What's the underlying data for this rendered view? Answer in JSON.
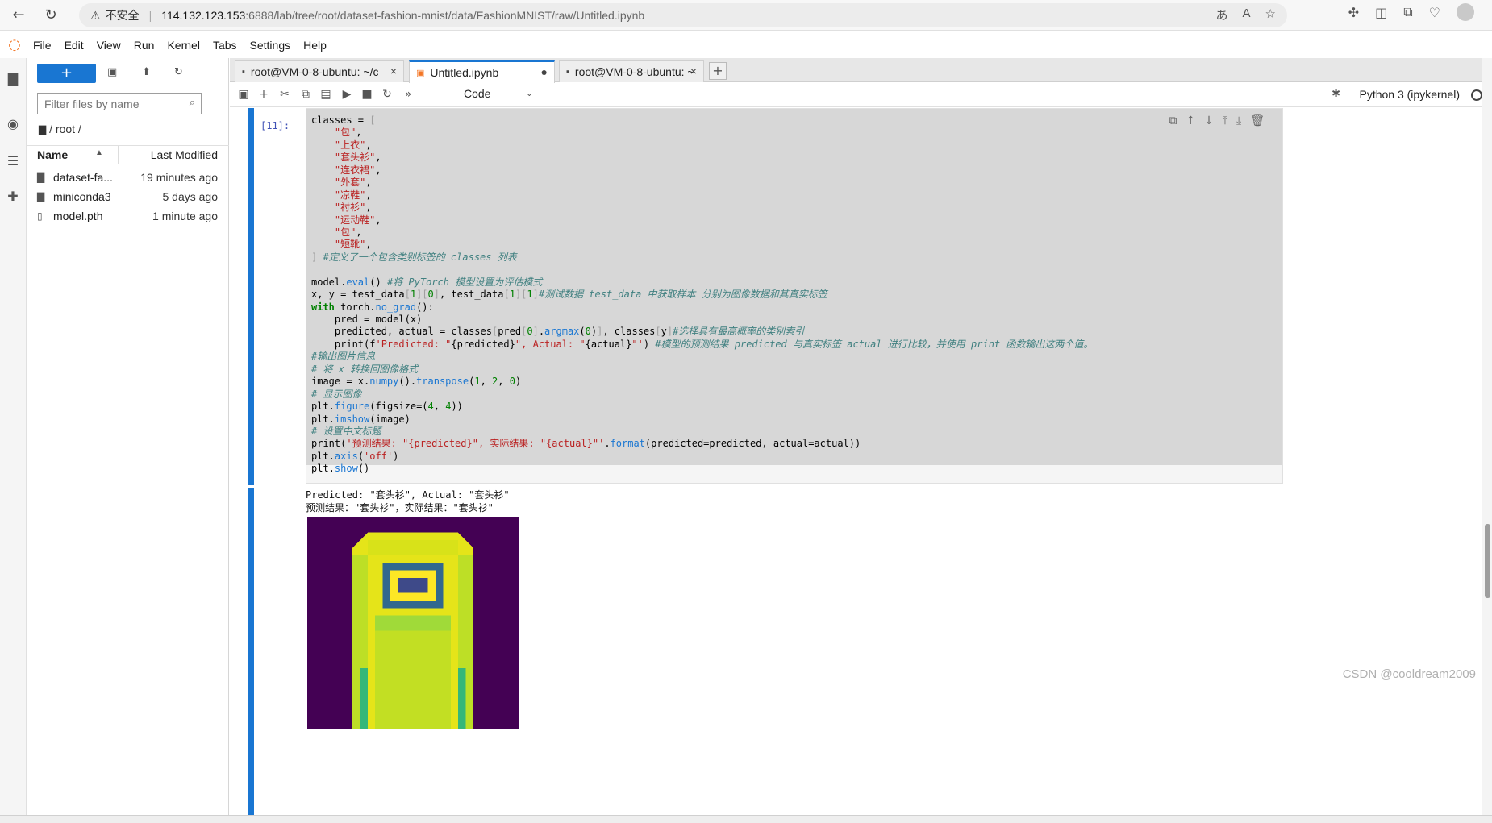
{
  "browser": {
    "warning_label": "不安全",
    "url_host": "114.132.123.153",
    "url_path": ":6888/lab/tree/root/dataset-fashion-mnist/data/FashionMNIST/raw/Untitled.ipynb"
  },
  "menu": {
    "items": [
      "File",
      "Edit",
      "View",
      "Run",
      "Kernel",
      "Tabs",
      "Settings",
      "Help"
    ]
  },
  "file_browser": {
    "new_label": "+",
    "search_placeholder": "Filter files by name",
    "breadcrumb": "/ root /",
    "col_name": "Name",
    "col_modified": "Last Modified",
    "files": [
      {
        "name": "dataset-fa...",
        "modified": "19 minutes ago",
        "icon": "folder-icon"
      },
      {
        "name": "miniconda3",
        "modified": "5 days ago",
        "icon": "folder-icon"
      },
      {
        "name": "model.pth",
        "modified": "1 minute ago",
        "icon": "file-icon"
      }
    ]
  },
  "tabs": [
    {
      "label": "root@VM-0-8-ubuntu: ~/c",
      "icon": "terminal-icon",
      "close": "×"
    },
    {
      "label": "Untitled.ipynb",
      "icon": "notebook-icon",
      "close": "●"
    },
    {
      "label": "root@VM-0-8-ubuntu: ~",
      "icon": "terminal-icon",
      "close": "×"
    }
  ],
  "toolbar": {
    "cell_type": "Code",
    "kernel_name": "Python 3 (ipykernel)"
  },
  "cell": {
    "prompt": "[11]:",
    "output_lines": [
      "Predicted: \"套头衫\", Actual: \"套头衫\"",
      "预测结果：\"套头衫\"，实际结果：\"套头衫\""
    ]
  },
  "watermark": "CSDN @cooldream2009",
  "colors": {
    "accent": "#1976d2",
    "jupyter_orange": "#f37626",
    "image_background": "#440154",
    "image_foreground": "#fde725"
  }
}
